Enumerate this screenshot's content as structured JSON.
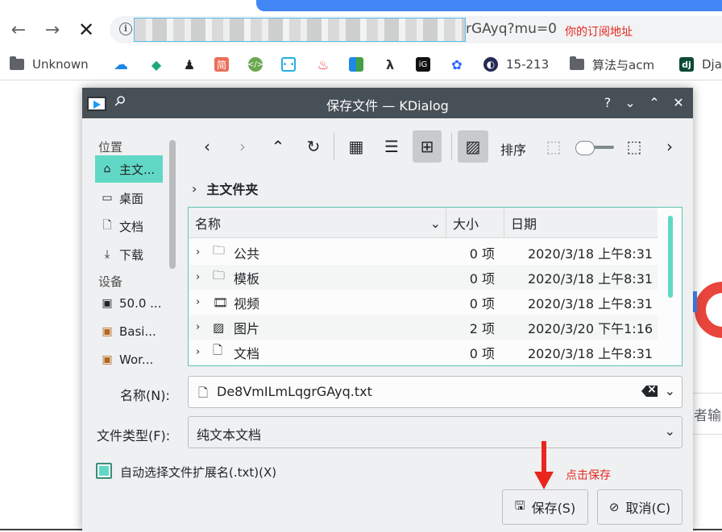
{
  "browser": {
    "url_tail": "rGAyq?mu=0",
    "url_annotation": "你的订阅地址",
    "bookmarks": [
      {
        "label": "Unknown",
        "icon": "folder-icon"
      },
      {
        "label": "",
        "icon": "cloud-icon"
      },
      {
        "label": "",
        "icon": "leaf-icon"
      },
      {
        "label": "",
        "icon": "penguin-icon"
      },
      {
        "label": "简",
        "icon": "jian-icon"
      },
      {
        "label": "",
        "icon": "code-icon"
      },
      {
        "label": "",
        "icon": "bilibili-icon"
      },
      {
        "label": "",
        "icon": "flame-icon"
      },
      {
        "label": "",
        "icon": "book-icon"
      },
      {
        "label": "",
        "icon": "lambda-icon"
      },
      {
        "label": "",
        "icon": "dark-logo-icon"
      },
      {
        "label": "",
        "icon": "paw-icon"
      },
      {
        "label": "15-213",
        "icon": "globe-icon"
      },
      {
        "label": "算法与acm",
        "icon": "folder-icon"
      },
      {
        "label": "Dja",
        "icon": "django-icon"
      }
    ],
    "bg_side_text": "者输"
  },
  "dialog": {
    "title": "保存文件 — KDialog",
    "places_heading": "位置",
    "devices_heading": "设备",
    "places": [
      {
        "label": "主文...",
        "icon": "home-icon",
        "selected": true
      },
      {
        "label": "桌面",
        "icon": "desktop-icon",
        "selected": false
      },
      {
        "label": "文档",
        "icon": "document-icon",
        "selected": false
      },
      {
        "label": "下载",
        "icon": "download-icon",
        "selected": false
      }
    ],
    "devices": [
      {
        "label": "50.0 ...",
        "icon": "drive-icon"
      },
      {
        "label": "Basi...",
        "icon": "drive-icon"
      },
      {
        "label": "Wor...",
        "icon": "drive-icon"
      }
    ],
    "sort_label": "排序",
    "breadcrumb": "主文件夹",
    "columns": {
      "name": "名称",
      "size": "大小",
      "date": "日期"
    },
    "rows": [
      {
        "name": "公共",
        "icon": "folder-icon",
        "size": "0 项",
        "date": "2020/3/18 上午8:31"
      },
      {
        "name": "模板",
        "icon": "folder-icon",
        "size": "0 项",
        "date": "2020/3/18 上午8:31"
      },
      {
        "name": "视频",
        "icon": "film-icon",
        "size": "0 项",
        "date": "2020/3/18 上午8:31"
      },
      {
        "name": "图片",
        "icon": "image-icon",
        "size": "2 项",
        "date": "2020/3/20 下午1:16"
      },
      {
        "name": "文档",
        "icon": "document-icon",
        "size": "0 项",
        "date": "2020/3/18 上午8:31"
      }
    ],
    "name_label": "名称(N):",
    "name_value": "De8VmILmLqgrGAyq.txt",
    "type_label": "文件类型(F):",
    "type_value": "纯文本文档",
    "auto_ext_label": "自动选择文件扩展名(.txt)(X)",
    "auto_ext_checked": true,
    "save_label": "保存(S)",
    "cancel_label": "取消(C)",
    "save_annotation": "点击保存"
  },
  "colors": {
    "accent": "#61d8c6",
    "annotation_red": "#e8261e",
    "titlebar": "#475057",
    "browser_blue": "#4285f4"
  }
}
